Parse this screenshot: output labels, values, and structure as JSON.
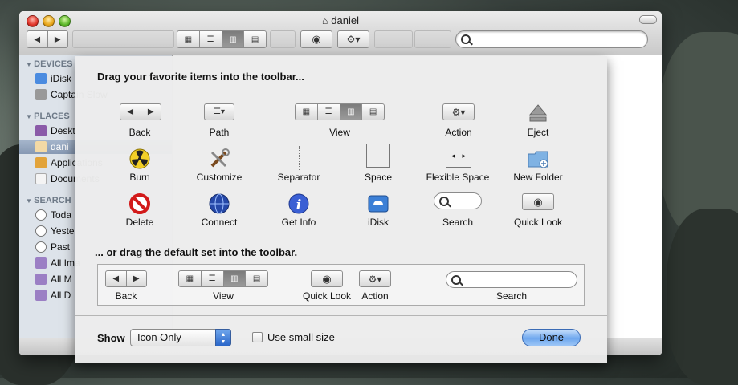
{
  "window": {
    "title": "daniel"
  },
  "sidebar": {
    "sections": [
      {
        "label": "DEVICES",
        "items": [
          "iDisk",
          "Captain Slow"
        ]
      },
      {
        "label": "PLACES",
        "items": [
          "Desktop",
          "daniel",
          "Applications",
          "Documents"
        ]
      },
      {
        "label": "SEARCH FOR",
        "items": [
          "Today",
          "Yesterday",
          "Past Week",
          "All Images",
          "All Movies",
          "All Documents"
        ]
      }
    ],
    "visible_labels": {
      "devices": "DEVICES",
      "idisk": "iDisk",
      "captain": "Captain Slow",
      "places": "PLACES",
      "desktop": "Deskt",
      "daniel": "dani",
      "applications": "Applications",
      "documents": "Documents",
      "search": "SEARCH",
      "today": "Toda",
      "yesterday": "Yeste",
      "pastweek": "Past",
      "allimages": "All Ima",
      "allmovies": "All M",
      "alldocs": "All D"
    }
  },
  "sheet": {
    "title": "Drag your favorite items into the toolbar...",
    "default_title": "... or drag the default set into the toolbar.",
    "items": {
      "back": "Back",
      "path": "Path",
      "view": "View",
      "action": "Action",
      "eject": "Eject",
      "burn": "Burn",
      "customize": "Customize",
      "separator": "Separator",
      "space": "Space",
      "flexible_space": "Flexible Space",
      "new_folder": "New Folder",
      "delete": "Delete",
      "connect": "Connect",
      "get_info": "Get Info",
      "idisk": "iDisk",
      "search": "Search",
      "quick_look": "Quick Look"
    },
    "default_set": {
      "back": "Back",
      "view": "View",
      "quick_look": "Quick Look",
      "action": "Action",
      "search": "Search"
    },
    "show_label": "Show",
    "show_value": "Icon Only",
    "small_size_label": "Use small size",
    "small_size_checked": false,
    "done_label": "Done"
  }
}
